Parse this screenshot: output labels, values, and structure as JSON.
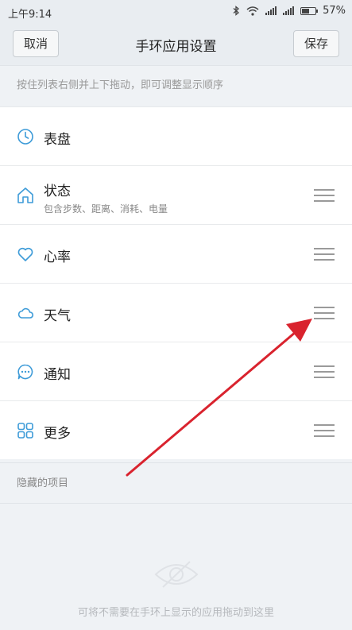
{
  "status_bar": {
    "time": "上午9:14",
    "battery_percent": "57%",
    "battery_level": 0.57,
    "icons": [
      "bluetooth-icon",
      "wifi-icon",
      "signal-icon",
      "signal-icon",
      "battery-icon"
    ]
  },
  "header": {
    "cancel_label": "取消",
    "title": "手环应用设置",
    "save_label": "保存"
  },
  "hint": "按住列表右侧并上下拖动，即可调整显示顺序",
  "items": [
    {
      "label": "表盘",
      "icon": "clock-icon",
      "draggable": false
    },
    {
      "label": "状态",
      "subtitle": "包含步数、距离、消耗、电量",
      "icon": "home-icon",
      "draggable": true
    },
    {
      "label": "心率",
      "icon": "heart-icon",
      "draggable": true
    },
    {
      "label": "天气",
      "icon": "cloud-icon",
      "draggable": true
    },
    {
      "label": "通知",
      "icon": "chat-icon",
      "draggable": true
    },
    {
      "label": "更多",
      "icon": "grid-icon",
      "draggable": true
    }
  ],
  "hidden_section": {
    "label": "隐藏的项目",
    "empty_text": "可将不需要在手环上显示的应用拖动到这里",
    "empty_icon": "eye-slash-icon"
  },
  "colors": {
    "icon_accent": "#3d9bd8",
    "annotation_arrow": "#d9232e"
  }
}
